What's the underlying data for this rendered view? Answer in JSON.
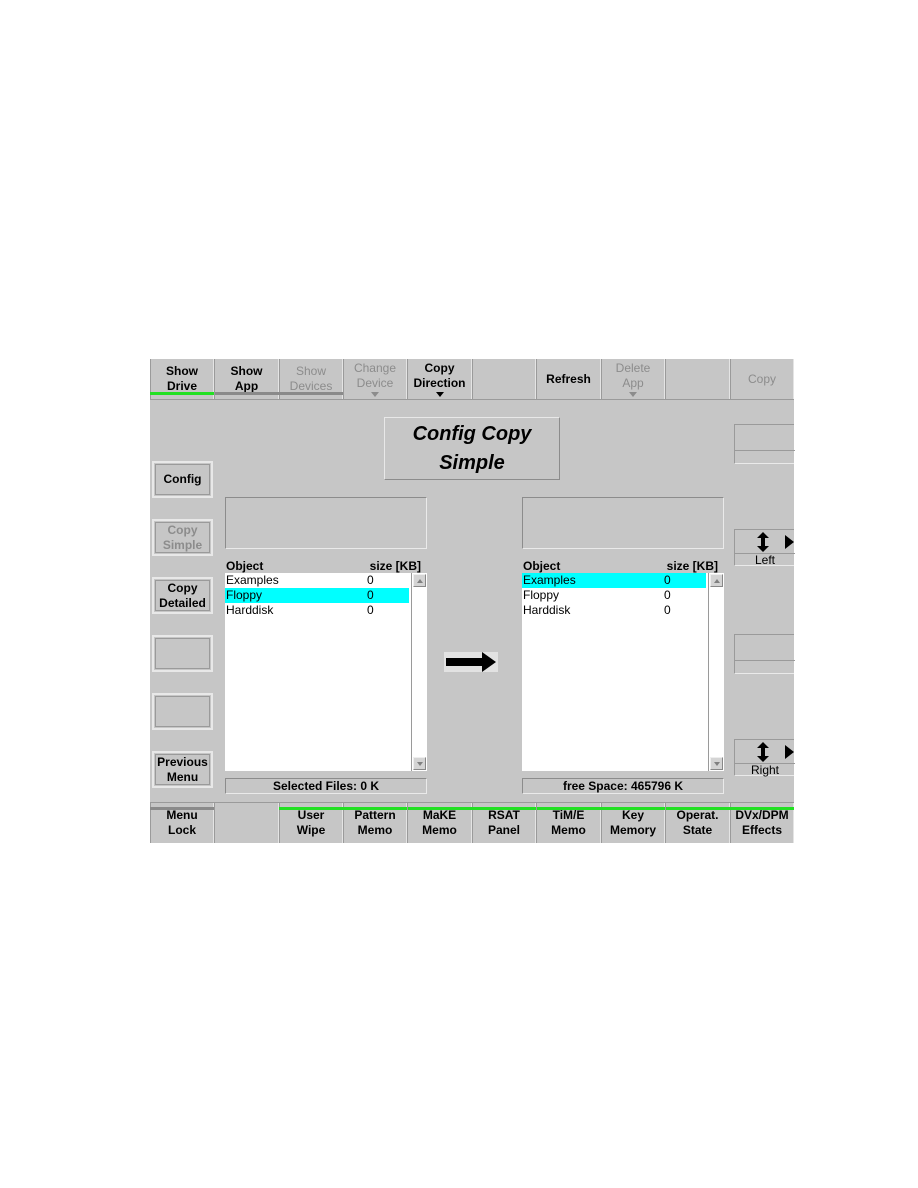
{
  "top_bar": [
    {
      "line1": "Show",
      "line2": "Drive",
      "disabled": false,
      "indicator": "green"
    },
    {
      "line1": "Show",
      "line2": "App",
      "disabled": false,
      "indicator": "gray"
    },
    {
      "line1": "Show",
      "line2": "Devices",
      "disabled": true,
      "indicator": "gray"
    },
    {
      "line1": "Change",
      "line2": "Device",
      "disabled": true,
      "caret": true
    },
    {
      "line1": "Copy",
      "line2": "Direction",
      "disabled": false,
      "caret": true
    },
    {
      "line1": "",
      "line2": "",
      "disabled": false
    },
    {
      "line1": "Refresh",
      "line2": "",
      "disabled": false
    },
    {
      "line1": "Delete",
      "line2": "App",
      "disabled": true,
      "caret": true
    },
    {
      "line1": "",
      "line2": "",
      "disabled": false
    },
    {
      "line1": "Copy",
      "line2": "",
      "disabled": true
    }
  ],
  "side_menu": [
    {
      "line1": "Config",
      "line2": "",
      "disabled": false
    },
    {
      "line1": "Copy",
      "line2": "Simple",
      "disabled": true
    },
    {
      "line1": "Copy",
      "line2": "Detailed",
      "disabled": false
    },
    {
      "line1": "",
      "line2": "",
      "disabled": false
    },
    {
      "line1": "",
      "line2": "",
      "disabled": false
    },
    {
      "line1": "Previous",
      "line2": "Menu",
      "disabled": false
    }
  ],
  "title": {
    "line1": "Config Copy",
    "line2": "Simple"
  },
  "source_list": {
    "col_object": "Object",
    "col_size": "size [KB]",
    "rows": [
      {
        "name": "Examples",
        "size": "0",
        "selected": false
      },
      {
        "name": "Floppy",
        "size": "0",
        "selected": true
      },
      {
        "name": "Harddisk",
        "size": "0",
        "selected": false
      }
    ],
    "status": "Selected Files:  0 K"
  },
  "target_list": {
    "col_object": "Object",
    "col_size": "size [KB]",
    "rows": [
      {
        "name": "Examples",
        "size": "0",
        "selected": true
      },
      {
        "name": "Floppy",
        "size": "0",
        "selected": false
      },
      {
        "name": "Harddisk",
        "size": "0",
        "selected": false
      }
    ],
    "status": "free Space:  465796 K"
  },
  "copy_direction_icon": "arrow-right-icon",
  "knobs": [
    {
      "label": "Left"
    },
    {
      "label": "Right"
    }
  ],
  "bottom_bar": [
    {
      "line1": "Menu",
      "line2": "Lock",
      "indicator": "gray"
    },
    {
      "line1": "",
      "line2": "",
      "indicator": ""
    },
    {
      "line1": "User",
      "line2": "Wipe",
      "indicator": "green"
    },
    {
      "line1": "Pattern",
      "line2": "Memo",
      "indicator": "green"
    },
    {
      "line1": "MaKE",
      "line2": "Memo",
      "indicator": "green"
    },
    {
      "line1": "RSAT",
      "line2": "Panel",
      "indicator": "green"
    },
    {
      "line1": "TiM/E",
      "line2": "Memo",
      "indicator": "green"
    },
    {
      "line1": "Key",
      "line2": "Memory",
      "indicator": "green"
    },
    {
      "line1": "Operat.",
      "line2": "State",
      "indicator": "green"
    },
    {
      "line1": "DVx/DPM",
      "line2": "Effects",
      "indicator": "green"
    }
  ],
  "colors": {
    "panel_bg": "#c6c6c6",
    "indicator_active": "#22e022",
    "indicator_inactive": "#8a8a8a",
    "selection": "#00ffff",
    "disabled_text": "#8c8c8c"
  }
}
